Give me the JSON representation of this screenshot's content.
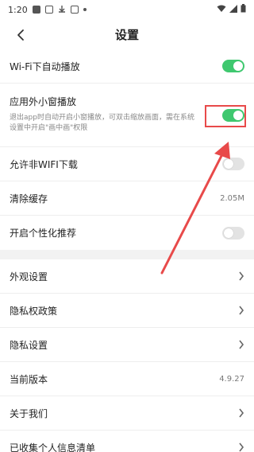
{
  "status": {
    "time": "1:20"
  },
  "header": {
    "title": "设置"
  },
  "settings": {
    "wifi_autoplay": {
      "label": "Wi-Fi下自动播放",
      "on": true
    },
    "mini_window": {
      "label": "应用外小窗播放",
      "desc": "退出app时自动开启小窗播放，可双击缩放画面，需在系统设置中开启\"画中画\"权限",
      "on": true
    },
    "non_wifi_download": {
      "label": "允许非WIFI下载",
      "on": false
    },
    "clear_cache": {
      "label": "清除缓存",
      "value": "2.05M"
    },
    "personalized": {
      "label": "开启个性化推荐",
      "on": false
    }
  },
  "menu": {
    "appearance": "外观设置",
    "privacy_policy": "隐私权政策",
    "privacy_settings": "隐私设置",
    "version_label": "当前版本",
    "version_value": "4.9.27",
    "about": "关于我们",
    "collected_info": "已收集个人信息清单"
  },
  "colors": {
    "toggle_on": "#3fc86f",
    "highlight": "#e84a4a"
  }
}
